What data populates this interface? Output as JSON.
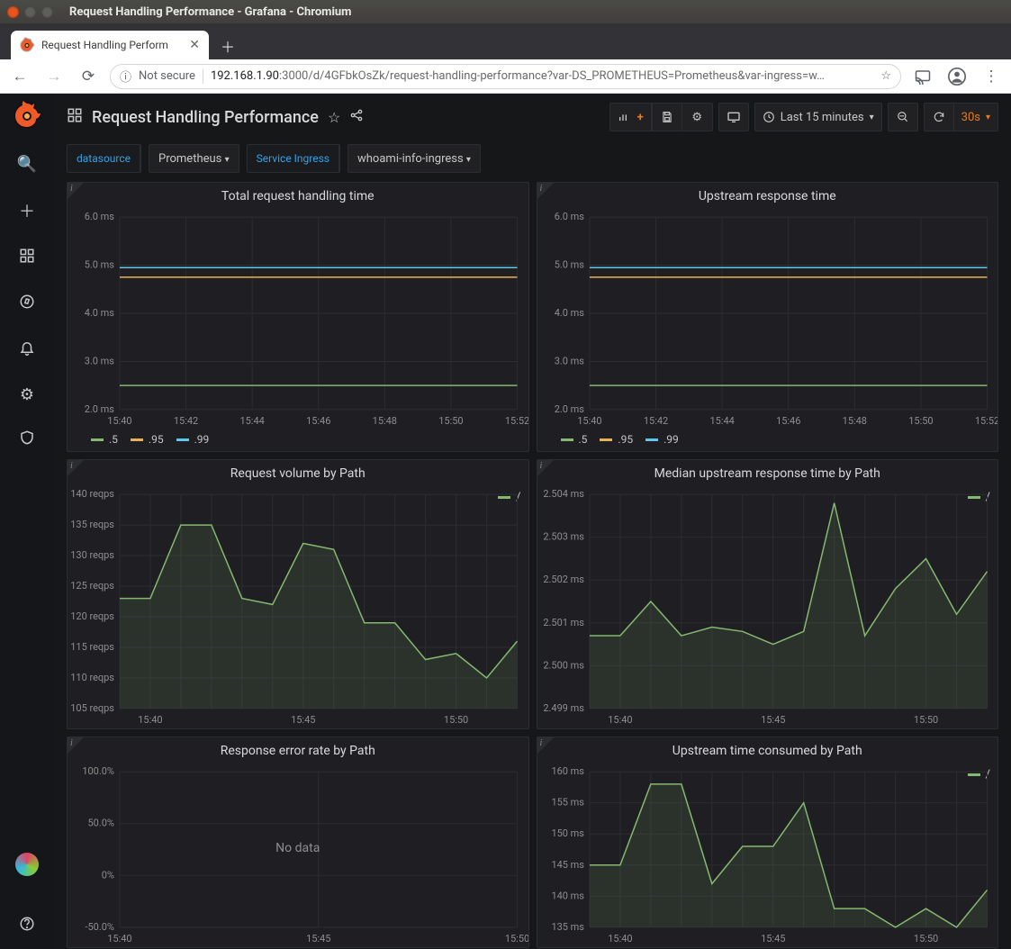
{
  "os": {
    "title": "Request Handling Performance - Grafana - Chromium"
  },
  "browser": {
    "tab_title": "Request Handling Perform",
    "not_secure": "Not secure",
    "url_host": "192.168.1.90",
    "url_rest": ":3000/d/4GFbkOsZk/request-handling-performance?var-DS_PROMETHEUS=Prometheus&var-ingress=w…"
  },
  "header": {
    "title": "Request Handling Performance",
    "time_label": "Last 15 minutes",
    "refresh_label": "30s"
  },
  "vars": {
    "ds_label": "datasource",
    "ds_value": "Prometheus",
    "svc_label": "Service Ingress",
    "svc_value": "whoami-info-ingress"
  },
  "legend_q": {
    "a": ".5",
    "b": ".95",
    "c": ".99"
  },
  "legend_path": {
    "a": "/"
  },
  "panel_titles": {
    "p1": "Total request handling time",
    "p2": "Upstream response time",
    "p3": "Request volume by Path",
    "p4": "Median upstream response time by Path",
    "p5": "Response error rate by Path",
    "p6": "Upstream time consumed by Path"
  },
  "nodata": "No data",
  "chart_data": [
    {
      "id": "p1",
      "type": "line",
      "title": "Total request handling time",
      "xlabel": "",
      "ylabel": "",
      "ylim": [
        2.0,
        6.0
      ],
      "yticks": [
        "2.0 ms",
        "3.0 ms",
        "4.0 ms",
        "5.0 ms",
        "6.0 ms"
      ],
      "x": [
        "15:40",
        "15:42",
        "15:44",
        "15:46",
        "15:48",
        "15:50",
        "15:52"
      ],
      "series": [
        {
          "name": ".5",
          "color": "#85b96f",
          "values": [
            2.5,
            2.5,
            2.5,
            2.5,
            2.5,
            2.5,
            2.5
          ]
        },
        {
          "name": ".95",
          "color": "#e5b354",
          "values": [
            4.75,
            4.75,
            4.75,
            4.75,
            4.75,
            4.75,
            4.75
          ]
        },
        {
          "name": ".99",
          "color": "#5ec7e8",
          "values": [
            4.95,
            4.95,
            4.95,
            4.95,
            4.95,
            4.95,
            4.95
          ]
        }
      ]
    },
    {
      "id": "p2",
      "type": "line",
      "title": "Upstream response time",
      "ylim": [
        2.0,
        6.0
      ],
      "yticks": [
        "2.0 ms",
        "3.0 ms",
        "4.0 ms",
        "5.0 ms",
        "6.0 ms"
      ],
      "x": [
        "15:40",
        "15:42",
        "15:44",
        "15:46",
        "15:48",
        "15:50",
        "15:52"
      ],
      "series": [
        {
          "name": ".5",
          "color": "#85b96f",
          "values": [
            2.5,
            2.5,
            2.5,
            2.5,
            2.5,
            2.5,
            2.5
          ]
        },
        {
          "name": ".95",
          "color": "#e5b354",
          "values": [
            4.75,
            4.75,
            4.75,
            4.75,
            4.75,
            4.75,
            4.75
          ]
        },
        {
          "name": ".99",
          "color": "#5ec7e8",
          "values": [
            4.95,
            4.95,
            4.95,
            4.95,
            4.95,
            4.95,
            4.95
          ]
        }
      ]
    },
    {
      "id": "p3",
      "type": "area",
      "title": "Request volume by Path",
      "ylim": [
        105,
        140
      ],
      "yticks": [
        "105 reqps",
        "110 reqps",
        "115 reqps",
        "120 reqps",
        "125 reqps",
        "130 reqps",
        "135 reqps",
        "140 reqps"
      ],
      "x": [
        "15:39",
        "15:40",
        "15:41",
        "15:42",
        "15:43",
        "15:44",
        "15:45",
        "15:46",
        "15:47",
        "15:48",
        "15:49",
        "15:50",
        "15:51",
        "15:52"
      ],
      "series": [
        {
          "name": "/",
          "color": "#85b96f",
          "values": [
            123,
            123,
            135,
            135,
            123,
            122,
            132,
            131,
            119,
            119,
            113,
            114,
            110,
            116
          ]
        }
      ]
    },
    {
      "id": "p4",
      "type": "area",
      "title": "Median upstream response time by Path",
      "ylim": [
        2.499,
        2.504
      ],
      "yticks": [
        "2.499 ms",
        "2.500 ms",
        "2.501 ms",
        "2.502 ms",
        "2.503 ms",
        "2.504 ms"
      ],
      "x": [
        "15:39",
        "15:40",
        "15:41",
        "15:42",
        "15:43",
        "15:44",
        "15:45",
        "15:46",
        "15:47",
        "15:48",
        "15:49",
        "15:50",
        "15:51",
        "15:52"
      ],
      "series": [
        {
          "name": "/",
          "color": "#85b96f",
          "values": [
            2.5007,
            2.5007,
            2.5015,
            2.5007,
            2.5009,
            2.5008,
            2.5005,
            2.5008,
            2.5038,
            2.5007,
            2.5018,
            2.5025,
            2.5012,
            2.5022
          ]
        }
      ]
    },
    {
      "id": "p5",
      "type": "line",
      "title": "Response error rate by Path",
      "ylim": [
        -50,
        100
      ],
      "yticks": [
        "-50.0%",
        "0%",
        "50.0%",
        "100.0%"
      ],
      "x": [
        "15:40",
        "15:45",
        "15:50"
      ],
      "series": [],
      "nodata": true
    },
    {
      "id": "p6",
      "type": "area",
      "title": "Upstream time consumed by Path",
      "ylim": [
        135,
        160
      ],
      "yticks": [
        "135 ms",
        "140 ms",
        "145 ms",
        "150 ms",
        "155 ms",
        "160 ms"
      ],
      "x": [
        "15:39",
        "15:40",
        "15:41",
        "15:42",
        "15:43",
        "15:44",
        "15:45",
        "15:46",
        "15:47",
        "15:48",
        "15:49",
        "15:50",
        "15:51",
        "15:52"
      ],
      "series": [
        {
          "name": "/",
          "color": "#85b96f",
          "values": [
            145,
            145,
            158,
            158,
            142,
            148,
            148,
            155,
            138,
            138,
            135,
            138,
            135,
            141
          ]
        }
      ]
    }
  ]
}
